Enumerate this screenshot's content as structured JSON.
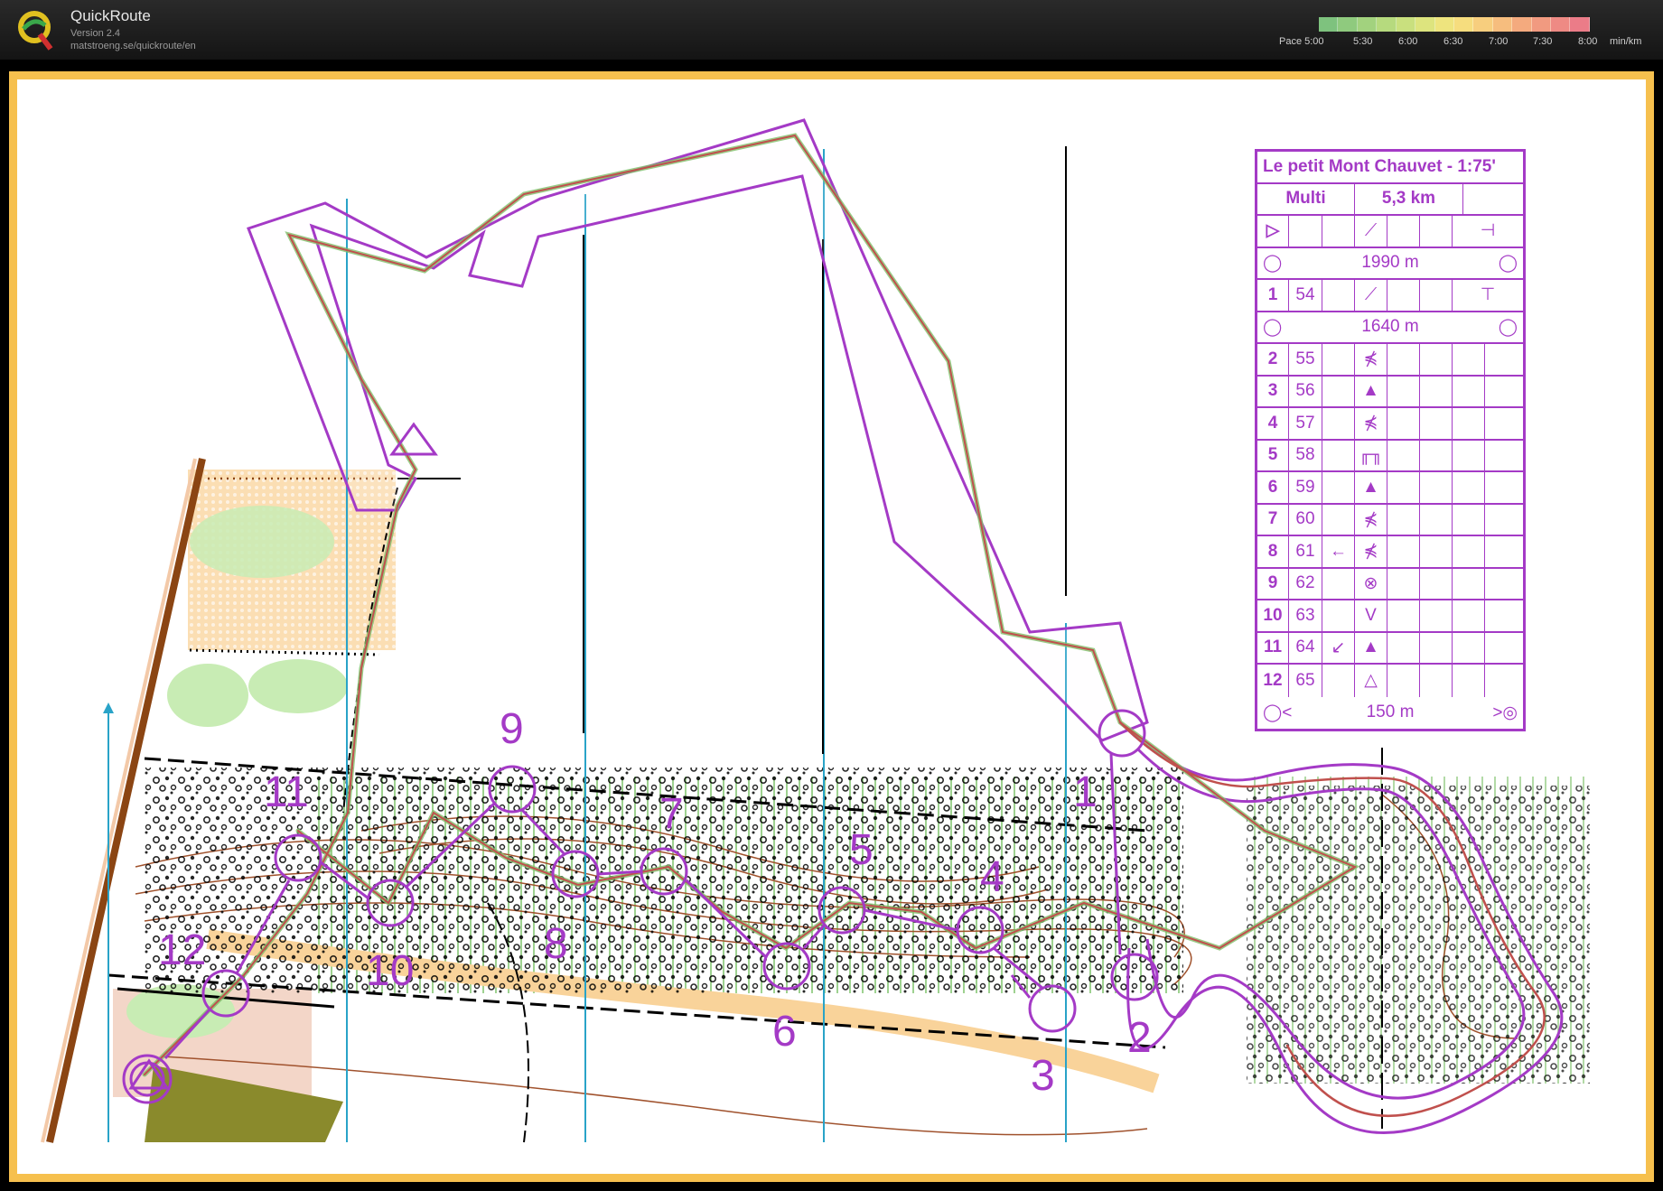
{
  "app": {
    "title": "QuickRoute",
    "version": "Version 2.4",
    "url": "matstroeng.se/quickroute/en"
  },
  "pace_scale": {
    "prefix": "Pace 5:00",
    "labels": [
      "5:30",
      "6:00",
      "6:30",
      "7:00",
      "7:30",
      "8:00"
    ],
    "unit": "min/km",
    "colors": [
      "#7ec27e",
      "#8fca7e",
      "#a2d27e",
      "#b6da7e",
      "#c9e07e",
      "#dde47e",
      "#eee47e",
      "#f6dd7e",
      "#f7ce7e",
      "#f6bd7e",
      "#f4aa7e",
      "#f19a80",
      "#ee8a84",
      "#eb7c88"
    ]
  },
  "colors": {
    "frame": "#f6c04e",
    "course": "#a43ac6",
    "route": "#c0504d",
    "vegetation": "#c8ecb4",
    "open_land": "#f9d39a",
    "contour": "#a0522d"
  },
  "course_table": {
    "title": "Le petit Mont Chauvet - 1:75'",
    "class": "Multi",
    "length": "5,3 km",
    "legs": [
      {
        "label": "1990 m"
      },
      {
        "label": "1640 m"
      },
      {
        "label": "150 m"
      }
    ],
    "controls": [
      {
        "n": "1",
        "code": "54",
        "dir": "",
        "feature": "⟋",
        "extra": "⊤"
      },
      {
        "n": "2",
        "code": "55",
        "dir": "",
        "feature": "⋠",
        "extra": ""
      },
      {
        "n": "3",
        "code": "56",
        "dir": "",
        "feature": "▲",
        "extra": ""
      },
      {
        "n": "4",
        "code": "57",
        "dir": "",
        "feature": "⋠",
        "extra": ""
      },
      {
        "n": "5",
        "code": "58",
        "dir": "",
        "feature": "╓╖",
        "extra": ""
      },
      {
        "n": "6",
        "code": "59",
        "dir": "",
        "feature": "▲",
        "extra": ""
      },
      {
        "n": "7",
        "code": "60",
        "dir": "",
        "feature": "⋠",
        "extra": ""
      },
      {
        "n": "8",
        "code": "61",
        "dir": "←",
        "feature": "⋠",
        "extra": ""
      },
      {
        "n": "9",
        "code": "62",
        "dir": "",
        "feature": "⊗",
        "extra": ""
      },
      {
        "n": "10",
        "code": "63",
        "dir": "",
        "feature": "V",
        "extra": ""
      },
      {
        "n": "11",
        "code": "64",
        "dir": "↙",
        "feature": "▲",
        "extra": ""
      },
      {
        "n": "12",
        "code": "65",
        "dir": "",
        "feature": "△",
        "extra": ""
      }
    ]
  },
  "map_labels": [
    "1",
    "2",
    "3",
    "4",
    "5",
    "6",
    "7",
    "8",
    "9",
    "10",
    "11",
    "12"
  ]
}
